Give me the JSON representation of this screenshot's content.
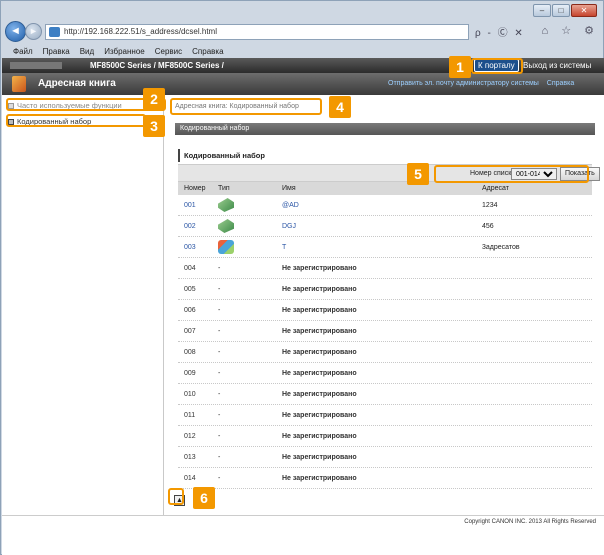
{
  "browser": {
    "url": "http://192.168.222.51/s_address/dcsel.html",
    "menu": [
      "Файл",
      "Правка",
      "Вид",
      "Избранное",
      "Сервис",
      "Справка"
    ],
    "tools": "ρ - Ⓒ ✕",
    "tab_icons": "⌂ ☆ ⚙"
  },
  "device": {
    "title": "MF8500C Series / MF8500C Series /",
    "portal": "К порталу",
    "logout": "Выход из системы"
  },
  "header": {
    "title": "Адресная книга",
    "links": [
      "Отправить эл. почту администратору системы",
      "Справка"
    ]
  },
  "sidebar": {
    "items": [
      {
        "label": "Часто используемые функции"
      },
      {
        "label": "Кодированный набор"
      }
    ]
  },
  "main": {
    "breadcrumb": "Адресная книга: Кодированный набор",
    "section": "Кодированный набор",
    "panel_title": "Кодированный набор",
    "list_label": "Номер списка:",
    "list_value": "001-014",
    "show_button": "Показать",
    "columns": [
      "Номер",
      "Тип",
      "Имя",
      "Адресат"
    ],
    "rows": [
      {
        "num": "001",
        "type": "fax",
        "name": "@AD",
        "dest": "1234",
        "registered": true
      },
      {
        "num": "002",
        "type": "fax",
        "name": "DGJ",
        "dest": "456",
        "registered": true
      },
      {
        "num": "003",
        "type": "group",
        "name": "T",
        "dest": "3адресатов",
        "registered": true
      },
      {
        "num": "004",
        "type": "-",
        "name": "Не зарегистрировано",
        "dest": "",
        "registered": false
      },
      {
        "num": "005",
        "type": "-",
        "name": "Не зарегистрировано",
        "dest": "",
        "registered": false
      },
      {
        "num": "006",
        "type": "-",
        "name": "Не зарегистрировано",
        "dest": "",
        "registered": false
      },
      {
        "num": "007",
        "type": "-",
        "name": "Не зарегистрировано",
        "dest": "",
        "registered": false
      },
      {
        "num": "008",
        "type": "-",
        "name": "Не зарегистрировано",
        "dest": "",
        "registered": false
      },
      {
        "num": "009",
        "type": "-",
        "name": "Не зарегистрировано",
        "dest": "",
        "registered": false
      },
      {
        "num": "010",
        "type": "-",
        "name": "Не зарегистрировано",
        "dest": "",
        "registered": false
      },
      {
        "num": "011",
        "type": "-",
        "name": "Не зарегистрировано",
        "dest": "",
        "registered": false
      },
      {
        "num": "012",
        "type": "-",
        "name": "Не зарегистрировано",
        "dest": "",
        "registered": false
      },
      {
        "num": "013",
        "type": "-",
        "name": "Не зарегистрировано",
        "dest": "",
        "registered": false
      },
      {
        "num": "014",
        "type": "-",
        "name": "Не зарегистрировано",
        "dest": "",
        "registered": false
      }
    ]
  },
  "footer": {
    "copyright": "Copyright CANON INC. 2013 All Rights Reserved"
  },
  "callouts": [
    "1",
    "2",
    "3",
    "4",
    "5",
    "6"
  ],
  "colors": {
    "callout": "#f39800",
    "link": "#2a55a5"
  }
}
